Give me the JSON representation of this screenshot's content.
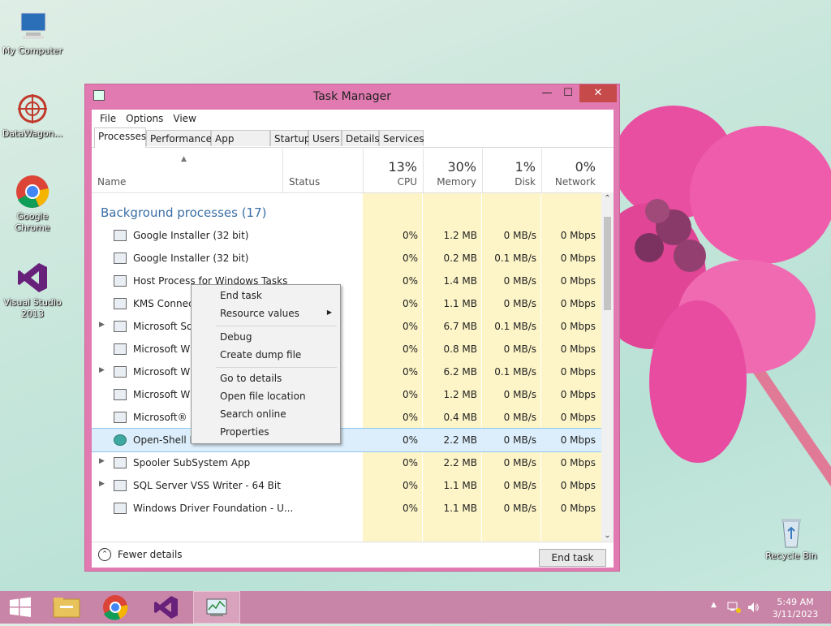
{
  "desktop": {
    "icons": [
      {
        "label": "My Computer"
      },
      {
        "label": "DataWagon..."
      },
      {
        "label": "Google Chrome"
      },
      {
        "label": "Visual Studio 2013"
      },
      {
        "label": "Recycle Bin"
      }
    ]
  },
  "window": {
    "title": "Task Manager",
    "controls": {
      "minimize": "—",
      "maximize": "☐",
      "close": "✕"
    }
  },
  "menu": [
    "File",
    "Options",
    "View"
  ],
  "tabs": [
    "Processes",
    "Performance",
    "App history",
    "Startup",
    "Users",
    "Details",
    "Services"
  ],
  "columns": {
    "name": "Name",
    "status": "Status",
    "cpu": {
      "pct": "13%",
      "label": "CPU"
    },
    "memory": {
      "pct": "30%",
      "label": "Memory"
    },
    "disk": {
      "pct": "1%",
      "label": "Disk"
    },
    "network": {
      "pct": "0%",
      "label": "Network"
    }
  },
  "group": "Background processes (17)",
  "rows": [
    {
      "name": "Google Installer (32 bit)",
      "cpu": "0%",
      "mem": "1.2 MB",
      "disk": "0 MB/s",
      "net": "0 Mbps",
      "expand": false
    },
    {
      "name": "Google Installer (32 bit)",
      "cpu": "0%",
      "mem": "0.2 MB",
      "disk": "0.1 MB/s",
      "net": "0 Mbps",
      "expand": false
    },
    {
      "name": "Host Process for Windows Tasks",
      "cpu": "0%",
      "mem": "1.4 MB",
      "disk": "0 MB/s",
      "net": "0 Mbps",
      "expand": false
    },
    {
      "name": "KMS Connect",
      "cpu": "0%",
      "mem": "1.1 MB",
      "disk": "0 MB/s",
      "net": "0 Mbps",
      "expand": false
    },
    {
      "name": "Microsoft Soft",
      "cpu": "0%",
      "mem": "6.7 MB",
      "disk": "0.1 MB/s",
      "net": "0 Mbps",
      "expand": true
    },
    {
      "name": "Microsoft Win",
      "cpu": "0%",
      "mem": "0.8 MB",
      "disk": "0 MB/s",
      "net": "0 Mbps",
      "expand": false
    },
    {
      "name": "Microsoft Win",
      "cpu": "0%",
      "mem": "6.2 MB",
      "disk": "0.1 MB/s",
      "net": "0 Mbps",
      "expand": true
    },
    {
      "name": "Microsoft Win",
      "cpu": "0%",
      "mem": "1.2 MB",
      "disk": "0 MB/s",
      "net": "0 Mbps",
      "expand": false
    },
    {
      "name": "Microsoft® G",
      "cpu": "0%",
      "mem": "0.4 MB",
      "disk": "0 MB/s",
      "net": "0 Mbps",
      "expand": false
    },
    {
      "name": "Open-Shell Menu",
      "cpu": "0%",
      "mem": "2.2 MB",
      "disk": "0 MB/s",
      "net": "0 Mbps",
      "expand": false,
      "selected": true
    },
    {
      "name": "Spooler SubSystem App",
      "cpu": "0%",
      "mem": "2.2 MB",
      "disk": "0 MB/s",
      "net": "0 Mbps",
      "expand": true
    },
    {
      "name": "SQL Server VSS Writer - 64 Bit",
      "cpu": "0%",
      "mem": "1.1 MB",
      "disk": "0 MB/s",
      "net": "0 Mbps",
      "expand": true
    },
    {
      "name": "Windows Driver Foundation - U...",
      "cpu": "0%",
      "mem": "1.1 MB",
      "disk": "0 MB/s",
      "net": "0 Mbps",
      "expand": false
    }
  ],
  "context_menu": {
    "groups": [
      [
        "End task",
        "Resource values"
      ],
      [
        "Debug",
        "Create dump file"
      ],
      [
        "Go to details",
        "Open file location",
        "Search online",
        "Properties"
      ]
    ]
  },
  "footer": {
    "fewer_details": "Fewer details",
    "end_task": "End task"
  },
  "clock": {
    "time": "5:49 AM",
    "date": "3/11/2023"
  },
  "colors": {
    "window_frame": "#e07ab0",
    "group_header": "#3a6ea5",
    "taskbar": "#c985a7",
    "heat": "#fdf5c8"
  }
}
